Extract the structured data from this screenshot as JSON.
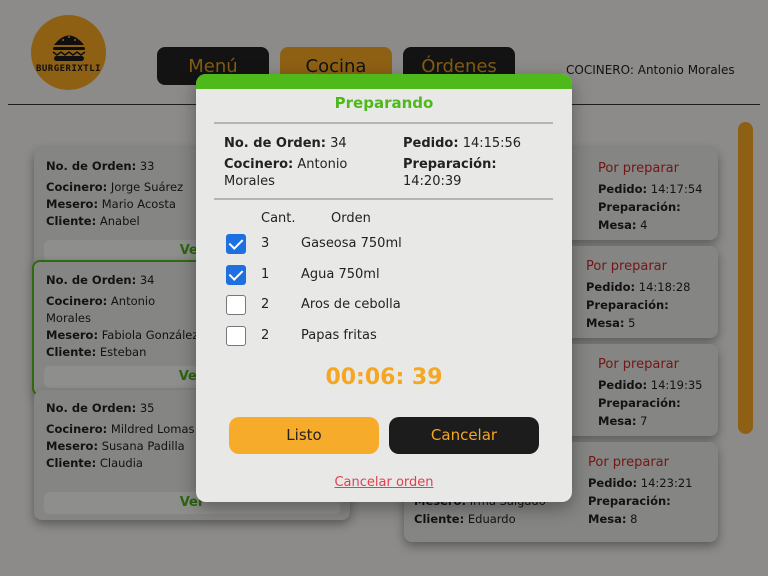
{
  "app": {
    "logo_text": "BURGERIXTLI"
  },
  "nav": {
    "menu": "Menú",
    "cocina": "Cocina",
    "ordenes": "Órdenes"
  },
  "cook_label": "COCINERO: Antonio Morales",
  "labels": {
    "order_no": "No. de Orden:",
    "cook": "Cocinero:",
    "waiter": "Mesero:",
    "client": "Cliente:",
    "ordered": "Pedido:",
    "prep": "Preparación:",
    "table": "Mesa:",
    "view": "Ver"
  },
  "left_cards": [
    {
      "order": "33",
      "cook": "Jorge Suárez",
      "waiter": "Mario Acosta",
      "client": "Anabel"
    },
    {
      "order": "34",
      "cook": "Antonio Morales",
      "waiter": "Fabiola González",
      "client": "Esteban"
    },
    {
      "order": "35",
      "cook": "Mildred Lomas",
      "waiter": "Susana Padilla",
      "client": "Claudia"
    }
  ],
  "right_cards": [
    {
      "status": "Por preparar",
      "ordered": "14:17:54",
      "table": "4"
    },
    {
      "status": "Por preparar",
      "ordered": "14:18:28",
      "table": "5"
    },
    {
      "status": "Por preparar",
      "ordered": "14:19:35",
      "table": "7"
    },
    {
      "status": "Por preparar",
      "ordered": "14:23:21",
      "table": "8",
      "waiter": "Irma Salgado",
      "client": "Eduardo"
    }
  ],
  "modal": {
    "title": "Preparando",
    "order_label": "No. de Orden:",
    "order_value": "34",
    "ordered_label": "Pedido:",
    "ordered_value": "14:15:56",
    "cook_label": "Cocinero:",
    "cook_value": "Antonio Morales",
    "prep_label": "Preparación:",
    "prep_value": "14:20:39",
    "col_qty": "Cant.",
    "col_order": "Orden",
    "items": [
      {
        "qty": "3",
        "name": "Gaseosa 750ml",
        "checked": true
      },
      {
        "qty": "1",
        "name": "Agua 750ml",
        "checked": true
      },
      {
        "qty": "2",
        "name": "Aros de cebolla",
        "checked": false
      },
      {
        "qty": "2",
        "name": "Papas fritas",
        "checked": false
      }
    ],
    "timer": "00:06: 39",
    "ready_label": "Listo",
    "cancel_label": "Cancelar",
    "cancel_order_label": "Cancelar orden"
  },
  "colors": {
    "accent_orange": "#f5a623",
    "accent_green": "#4fb81a",
    "status_red": "#c62828",
    "checkbox_blue": "#1e6fe0"
  },
  "icons": {
    "logo": "burger-icon"
  }
}
